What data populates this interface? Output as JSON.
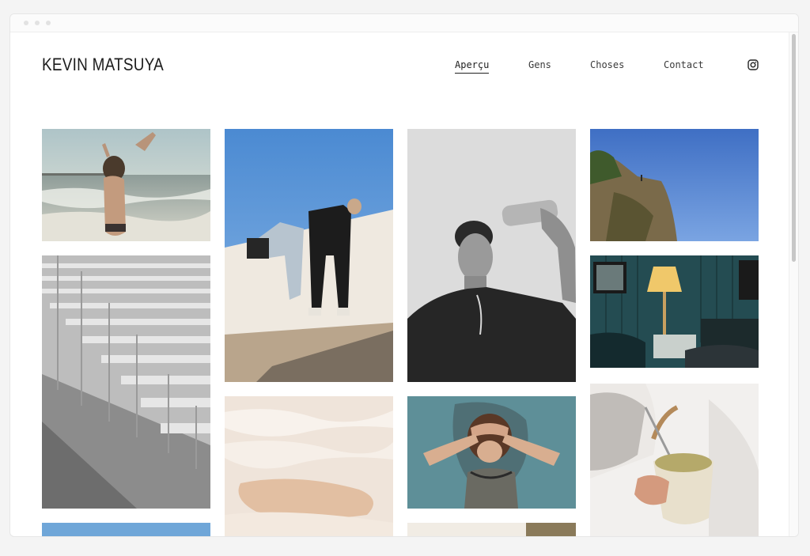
{
  "brand": {
    "name": "KEVIN MATSUYA"
  },
  "nav": {
    "items": [
      {
        "label": "Aperçu",
        "active": true
      },
      {
        "label": "Gens",
        "active": false
      },
      {
        "label": "Choses",
        "active": false
      },
      {
        "label": "Contact",
        "active": false
      }
    ],
    "instagram_icon": "instagram-icon"
  },
  "gallery": {
    "photos": [
      {
        "name": "photo-beach-waves",
        "subject": "beach-waves"
      },
      {
        "name": "photo-bleachers",
        "subject": "bleachers"
      },
      {
        "name": "photo-blue-wide-bottom",
        "subject": "sky"
      },
      {
        "name": "photo-wall-climbers",
        "subject": "wall-climbers"
      },
      {
        "name": "photo-salt-terraces",
        "subject": "salt-terraces"
      },
      {
        "name": "photo-water-bottle-portrait",
        "subject": "water-bottle-portrait"
      },
      {
        "name": "photo-woman-hands-face",
        "subject": "woman-hands-face"
      },
      {
        "name": "photo-partial-bottom",
        "subject": "partial"
      },
      {
        "name": "photo-cliff-sky",
        "subject": "cliff-sky"
      },
      {
        "name": "photo-lamp-room",
        "subject": "lamp-room"
      },
      {
        "name": "photo-teapot-cup",
        "subject": "teapot-cup"
      }
    ]
  },
  "colors": {
    "text": "#1c1c1c",
    "nav": "#3a3a3a",
    "background": "#ffffff"
  }
}
